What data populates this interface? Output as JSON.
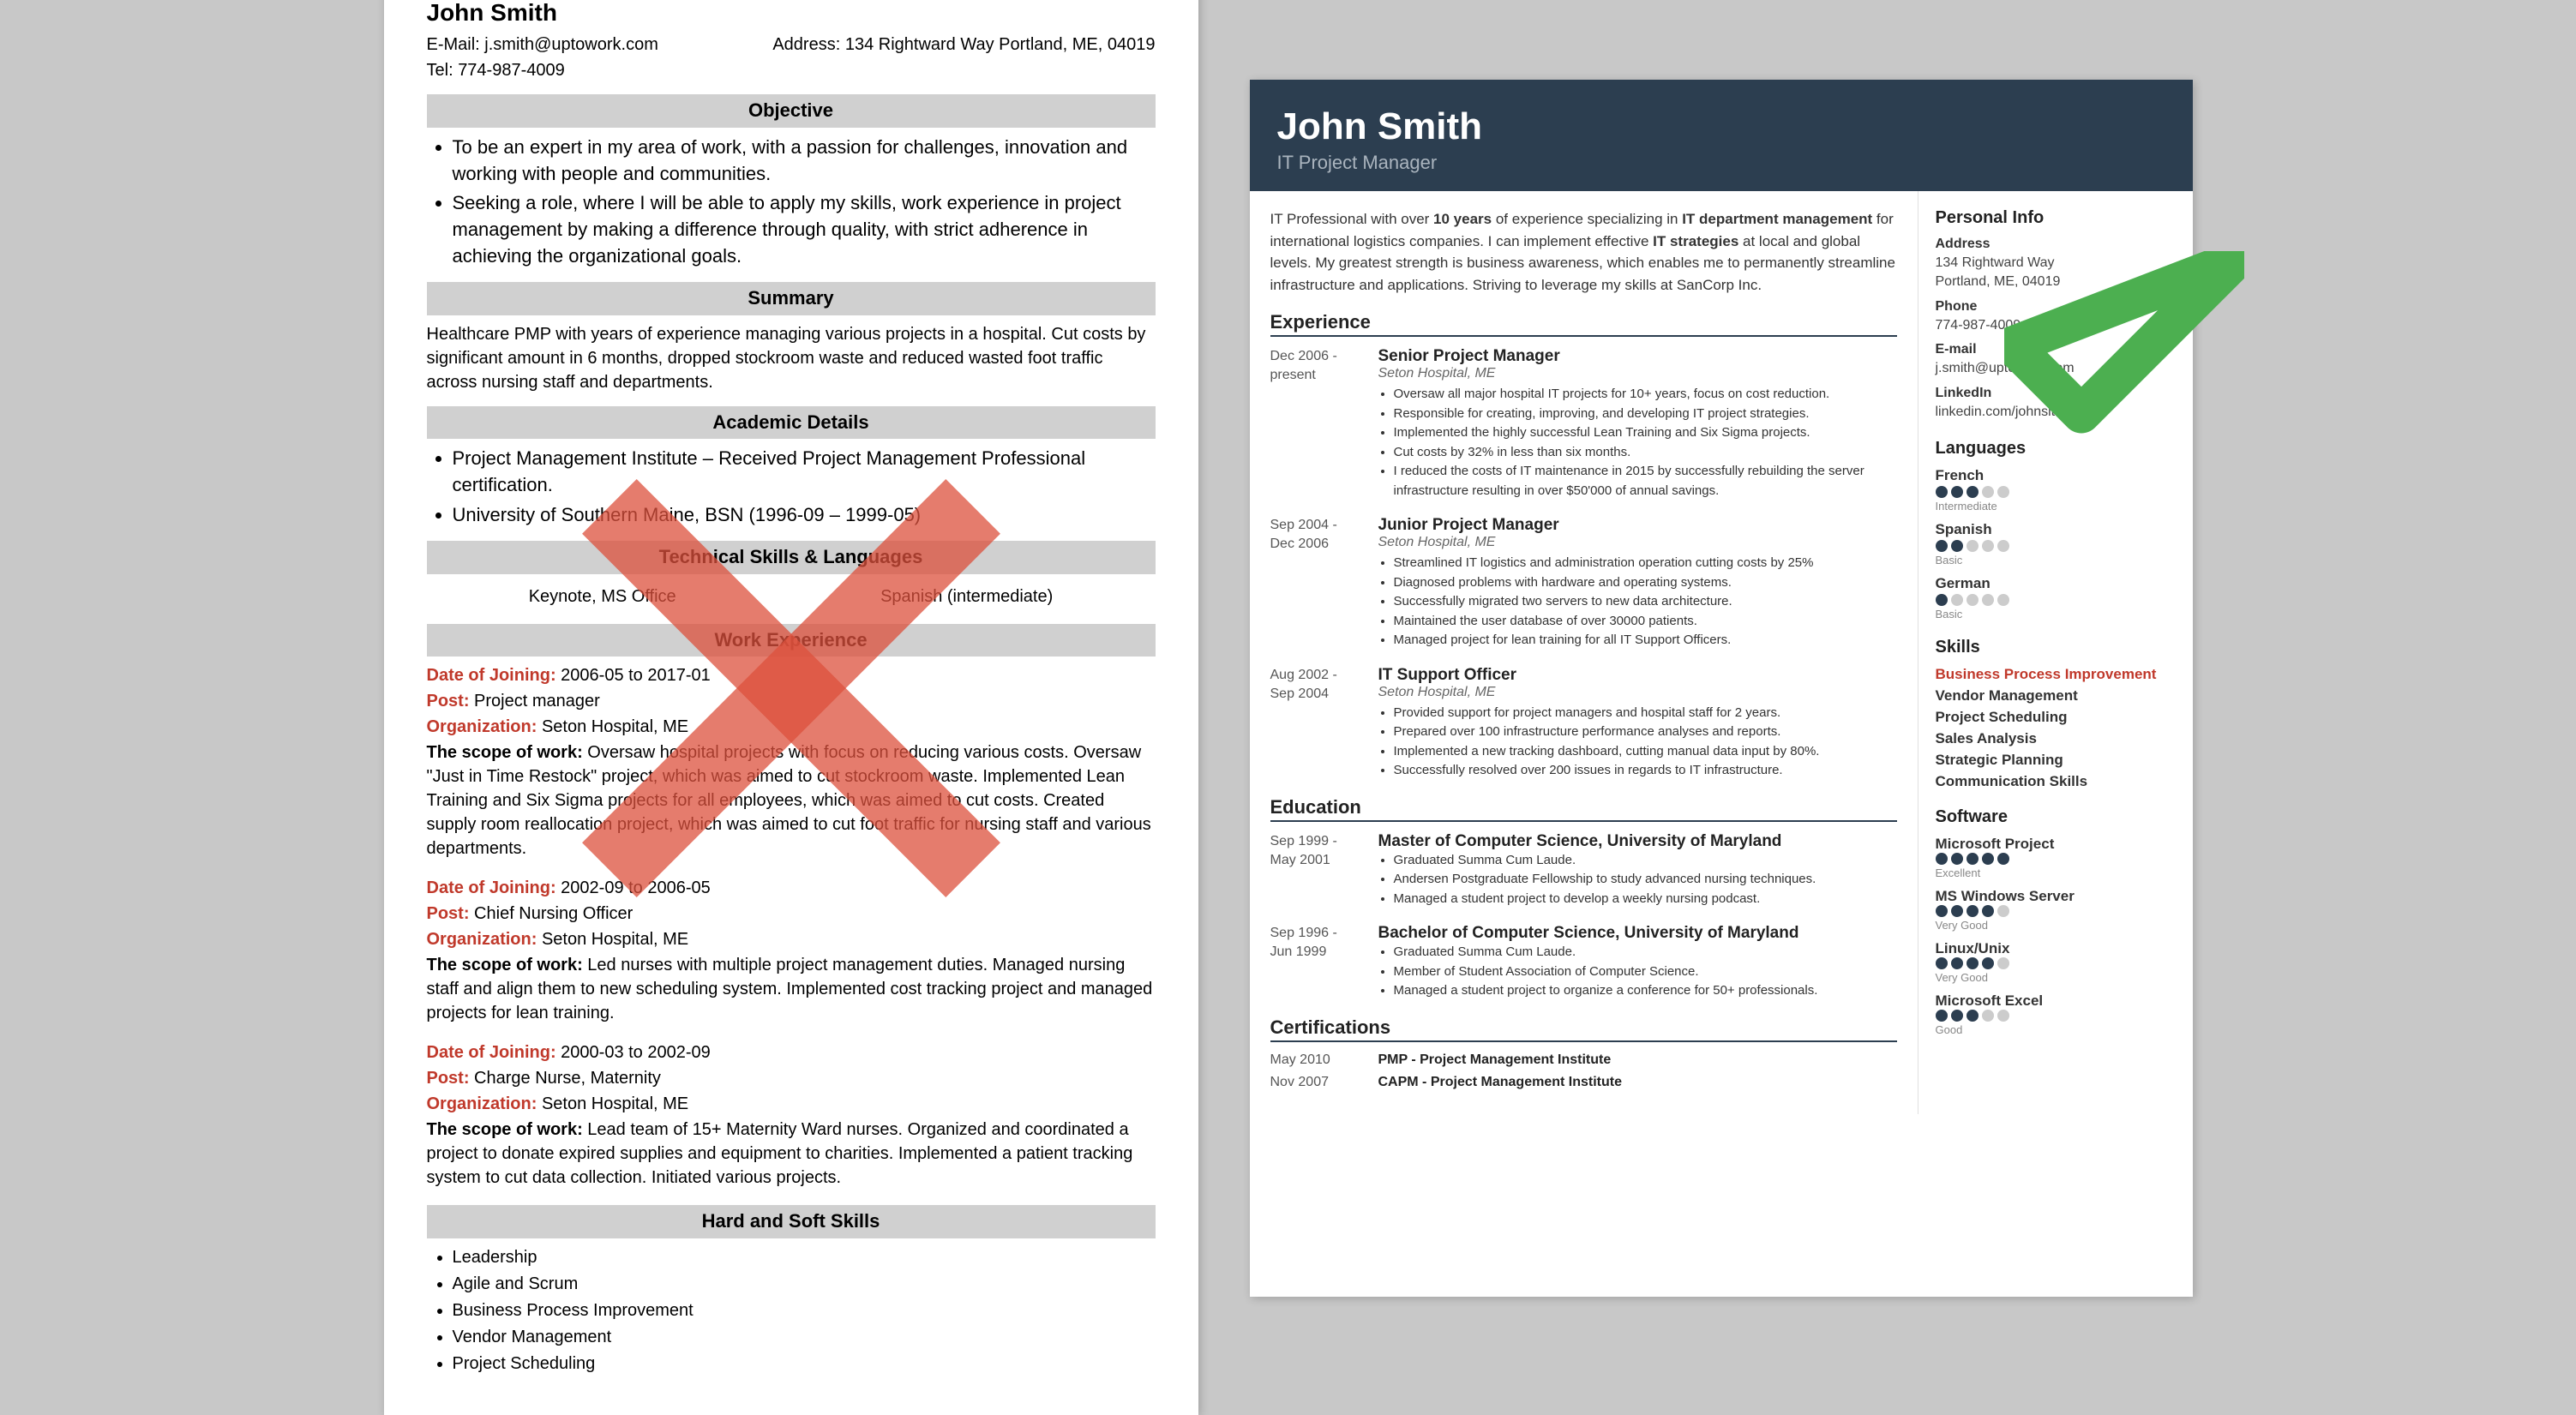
{
  "left": {
    "name": "John Smith",
    "email_label": "E-Mail:",
    "email": "j.smith@uptowork.com",
    "address_label": "Address:",
    "address": "134 Rightward Way Portland, ME, 04019",
    "tel_label": "Tel:",
    "tel": "774-987-4009",
    "sections": {
      "objective": {
        "title": "Objective",
        "bullets": [
          "To be an expert in my area of work, with a passion for challenges, innovation and working with people and communities.",
          "Seeking a role, where I will be able to apply my skills, work experience in project management by making a difference through quality, with strict adherence in achieving the organizational goals."
        ]
      },
      "summary": {
        "title": "Summary",
        "text": "Healthcare PMP with years of experience managing various projects in a hospital. Cut costs by significant amount in 6 months, dropped stockroom waste and reduced wasted foot traffic across nursing staff and departments."
      },
      "academic": {
        "title": "Academic Details",
        "bullets": [
          "Project Management Institute – Received Project Management Professional certification.",
          "University of Southern Maine, BSN (1996-09 – 1999-05)"
        ]
      },
      "skills": {
        "title": "Technical Skills & Languages",
        "col1": "Keynote, MS Office",
        "col2": "Spanish (intermediate)"
      },
      "work": {
        "title": "Work Experience",
        "entries": [
          {
            "date": "Date of Joining: 2006-05 to 2017-01",
            "post": "Post: Project manager",
            "org": "Organization: Seton Hospital, ME",
            "scope": "The scope of work: Oversaw hospital projects with focus on reducing various costs. Oversaw \"Just in Time Restock\" project, which was aimed to cut stockroom waste. Implemented Lean Training and Six Sigma projects for all employees, which was aimed to cut costs. Created supply room reallocation project, which was aimed to cut foot traffic for nursing staff and various departments."
          },
          {
            "date": "Date of Joining: 2002-09 to 2006-05",
            "post": "Post: Chief Nursing Officer",
            "org": "Organization: Seton Hospital, ME",
            "scope": "Led nurses with multiple project management duties. Managed nursing staff and align them to new scheduling system. Implemented cost tracking project and managed projects for lean training."
          },
          {
            "date": "Date of Joining: 2000-03 to 2002-09",
            "post": "Post: Charge Nurse, Maternity",
            "org": "Organization: Seton Hospital, ME",
            "scope": "Lead team of 15+ Maternity Ward nurses. Organized and coordinated a project to donate expired supplies and equipment to charities. Implemented a patient tracking system to cut data collection. Initiated various projects."
          }
        ]
      },
      "hardsoft": {
        "title": "Hard and Soft Skills",
        "bullets": [
          "Leadership",
          "Agile and Scrum",
          "Business Process Improvement",
          "Vendor Management",
          "Project Scheduling"
        ]
      }
    }
  },
  "right": {
    "name": "John Smith",
    "title": "IT Project Manager",
    "intro": "IT Professional with over 10 years of experience specializing in IT department management for international logistics companies. I can implement effective IT strategies at local and global levels. My greatest strength is business awareness, which enables me to permanently streamline infrastructure and applications. Striving to leverage my skills at SanCorp Inc.",
    "sections": {
      "experience": {
        "title": "Experience",
        "entries": [
          {
            "date": "Dec 2006 - present",
            "title": "Senior Project Manager",
            "org": "Seton Hospital, ME",
            "bullets": [
              "Oversaw all major hospital IT projects for 10+ years, focus on cost reduction.",
              "Responsible for creating, improving, and developing IT project strategies.",
              "Implemented the highly successful Lean Training and Six Sigma projects.",
              "Cut costs by 32% in less than six months.",
              "I reduced the costs of IT maintenance in 2015 by successfully rebuilding the server infrastructure resulting in over $50'000 of annual savings."
            ]
          },
          {
            "date": "Sep 2004 - Dec 2006",
            "title": "Junior Project Manager",
            "org": "Seton Hospital, ME",
            "bullets": [
              "Streamlined IT logistics and administration operation cutting costs by 25%",
              "Diagnosed problems with hardware and operating systems.",
              "Successfully migrated two servers to new data architecture.",
              "Maintained the user database of over 30000 patients.",
              "Managed project for lean training for all IT Support Officers."
            ]
          },
          {
            "date": "Aug 2002 - Sep 2004",
            "title": "IT Support Officer",
            "org": "Seton Hospital, ME",
            "bullets": [
              "Provided support for project managers and hospital staff for 2 years.",
              "Prepared over 100 infrastructure performance analyses and reports.",
              "Implemented a new tracking dashboard, cutting manual data input by 80%.",
              "Successfully resolved over 200 issues in regards to IT infrastructure."
            ]
          }
        ]
      },
      "education": {
        "title": "Education",
        "entries": [
          {
            "date": "Sep 1999 - May 2001",
            "title": "Master of Computer Science, University of Maryland",
            "bullets": [
              "Graduated Summa Cum Laude.",
              "Andersen Postgraduate Fellowship to study advanced nursing techniques.",
              "Managed a student project to develop a weekly nursing podcast."
            ]
          },
          {
            "date": "Sep 1996 - Jun 1999",
            "title": "Bachelor of Computer Science, University of Maryland",
            "bullets": [
              "Graduated Summa Cum Laude.",
              "Member of Student Association of Computer Science.",
              "Managed a student project to organize a conference for 50+ professionals."
            ]
          }
        ]
      },
      "certifications": {
        "title": "Certifications",
        "entries": [
          {
            "date": "May 2010",
            "title": "PMP - Project Management Institute"
          },
          {
            "date": "Nov 2007",
            "title": "CAPM - Project Management Institute"
          }
        ]
      }
    },
    "sidebar": {
      "personal_info": {
        "title": "Personal Info",
        "address_label": "Address",
        "address": "134 Rightward Way\nPortland, ME, 04019",
        "phone_label": "Phone",
        "phone": "774-987-4009",
        "email_label": "E-mail",
        "email": "j.smith@uptowork.com",
        "linkedin_label": "LinkedIn",
        "linkedin": "linkedin.com/johnsltw"
      },
      "languages": {
        "title": "Languages",
        "items": [
          {
            "name": "French",
            "filled": 3,
            "total": 5,
            "level": "Intermediate"
          },
          {
            "name": "Spanish",
            "filled": 2,
            "total": 5,
            "level": "Basic"
          },
          {
            "name": "German",
            "filled": 1,
            "total": 5,
            "level": "Basic"
          }
        ]
      },
      "skills": {
        "title": "Skills",
        "items": [
          {
            "name": "Business Process Improvement",
            "highlight": true
          },
          {
            "name": "Vendor Management",
            "highlight": false
          },
          {
            "name": "Project Scheduling",
            "highlight": false
          },
          {
            "name": "Sales Analysis",
            "highlight": false
          },
          {
            "name": "Strategic Planning",
            "highlight": false
          },
          {
            "name": "Communication Skills",
            "highlight": false
          }
        ]
      },
      "software": {
        "title": "Software",
        "items": [
          {
            "name": "Microsoft Project",
            "filled": 5,
            "total": 5,
            "level": "Excellent"
          },
          {
            "name": "MS Windows Server",
            "filled": 4,
            "total": 5,
            "level": "Very Good"
          },
          {
            "name": "Linux/Unix",
            "filled": 4,
            "total": 5,
            "level": "Very Good"
          },
          {
            "name": "Microsoft Excel",
            "filled": 3,
            "total": 5,
            "level": "Good"
          }
        ]
      }
    }
  }
}
